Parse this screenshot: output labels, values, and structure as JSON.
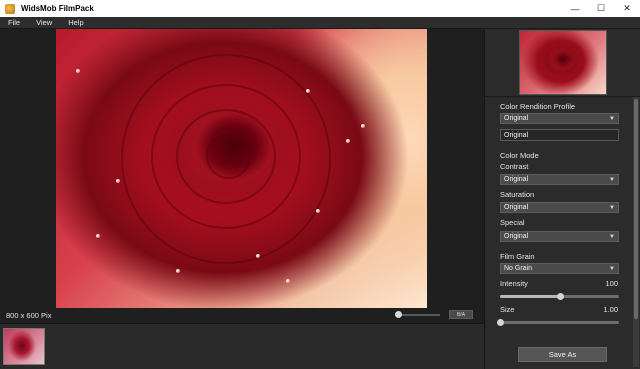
{
  "window": {
    "title": "WidsMob FilmPack",
    "minimize": "—",
    "maximize": "☐",
    "close": "✕"
  },
  "menu": [
    "File",
    "View",
    "Help"
  ],
  "viewer": {
    "dimensions": "800 x 600 Pix",
    "ba_label": "B/A",
    "zoom_level": 0.05
  },
  "panel": {
    "color_rendition_label": "Color Rendition Profile",
    "color_rendition_value": "Original",
    "color_rendition_field": "Original",
    "color_mode_label": "Color Mode",
    "contrast_label": "Contrast",
    "contrast_value": "Original",
    "saturation_label": "Saturation",
    "saturation_value": "Original",
    "special_label": "Special",
    "special_value": "Original",
    "film_grain_label": "Film Grain",
    "film_grain_value": "No Grain",
    "intensity_label": "Intensity",
    "intensity_value": "100",
    "intensity_fraction": 0.5,
    "size_label": "Size",
    "size_value": "1.00",
    "size_fraction": 0.0,
    "save_label": "Save As"
  },
  "icons": {
    "dropdown": "chevron-down-icon"
  }
}
